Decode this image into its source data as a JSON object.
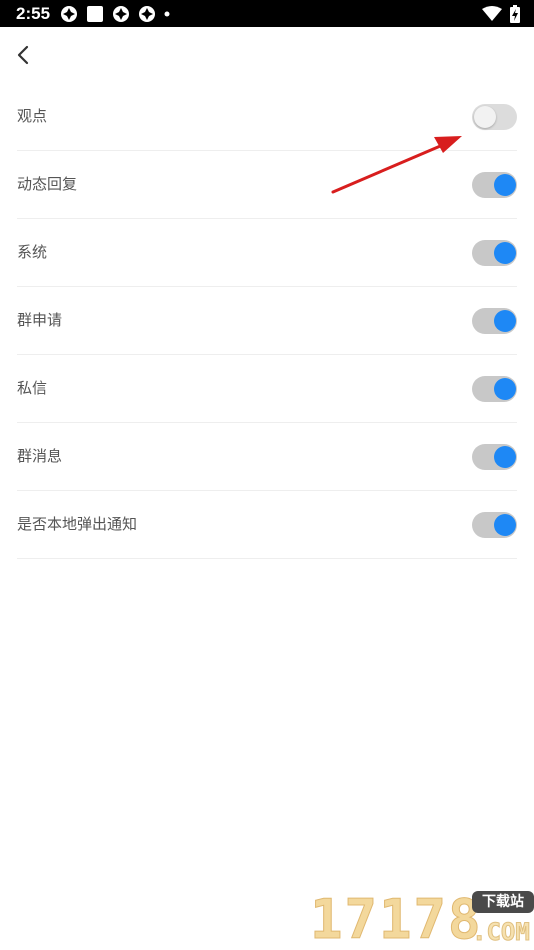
{
  "status_bar": {
    "time": "2:55",
    "icons": [
      "notification-icon",
      "notification-icon",
      "notification-icon",
      "notification-icon",
      "dot-icon"
    ],
    "right_icons": [
      "wifi-icon",
      "battery-icon"
    ]
  },
  "header": {
    "back_icon": "chevron-left-icon"
  },
  "settings": [
    {
      "label": "观点",
      "enabled": false
    },
    {
      "label": "动态回复",
      "enabled": true
    },
    {
      "label": "系统",
      "enabled": true
    },
    {
      "label": "群申请",
      "enabled": true
    },
    {
      "label": "私信",
      "enabled": true
    },
    {
      "label": "群消息",
      "enabled": true
    },
    {
      "label": "是否本地弹出通知",
      "enabled": true
    }
  ],
  "colors": {
    "toggle_on_knob": "#1e88f5",
    "toggle_track": "#c8c8c8",
    "toggle_off_knob": "#f2f2f2",
    "annotation_arrow": "#d81e1e"
  },
  "watermark": {
    "digits": "17178",
    "badge": "下载站",
    "suffix": ".COM"
  }
}
